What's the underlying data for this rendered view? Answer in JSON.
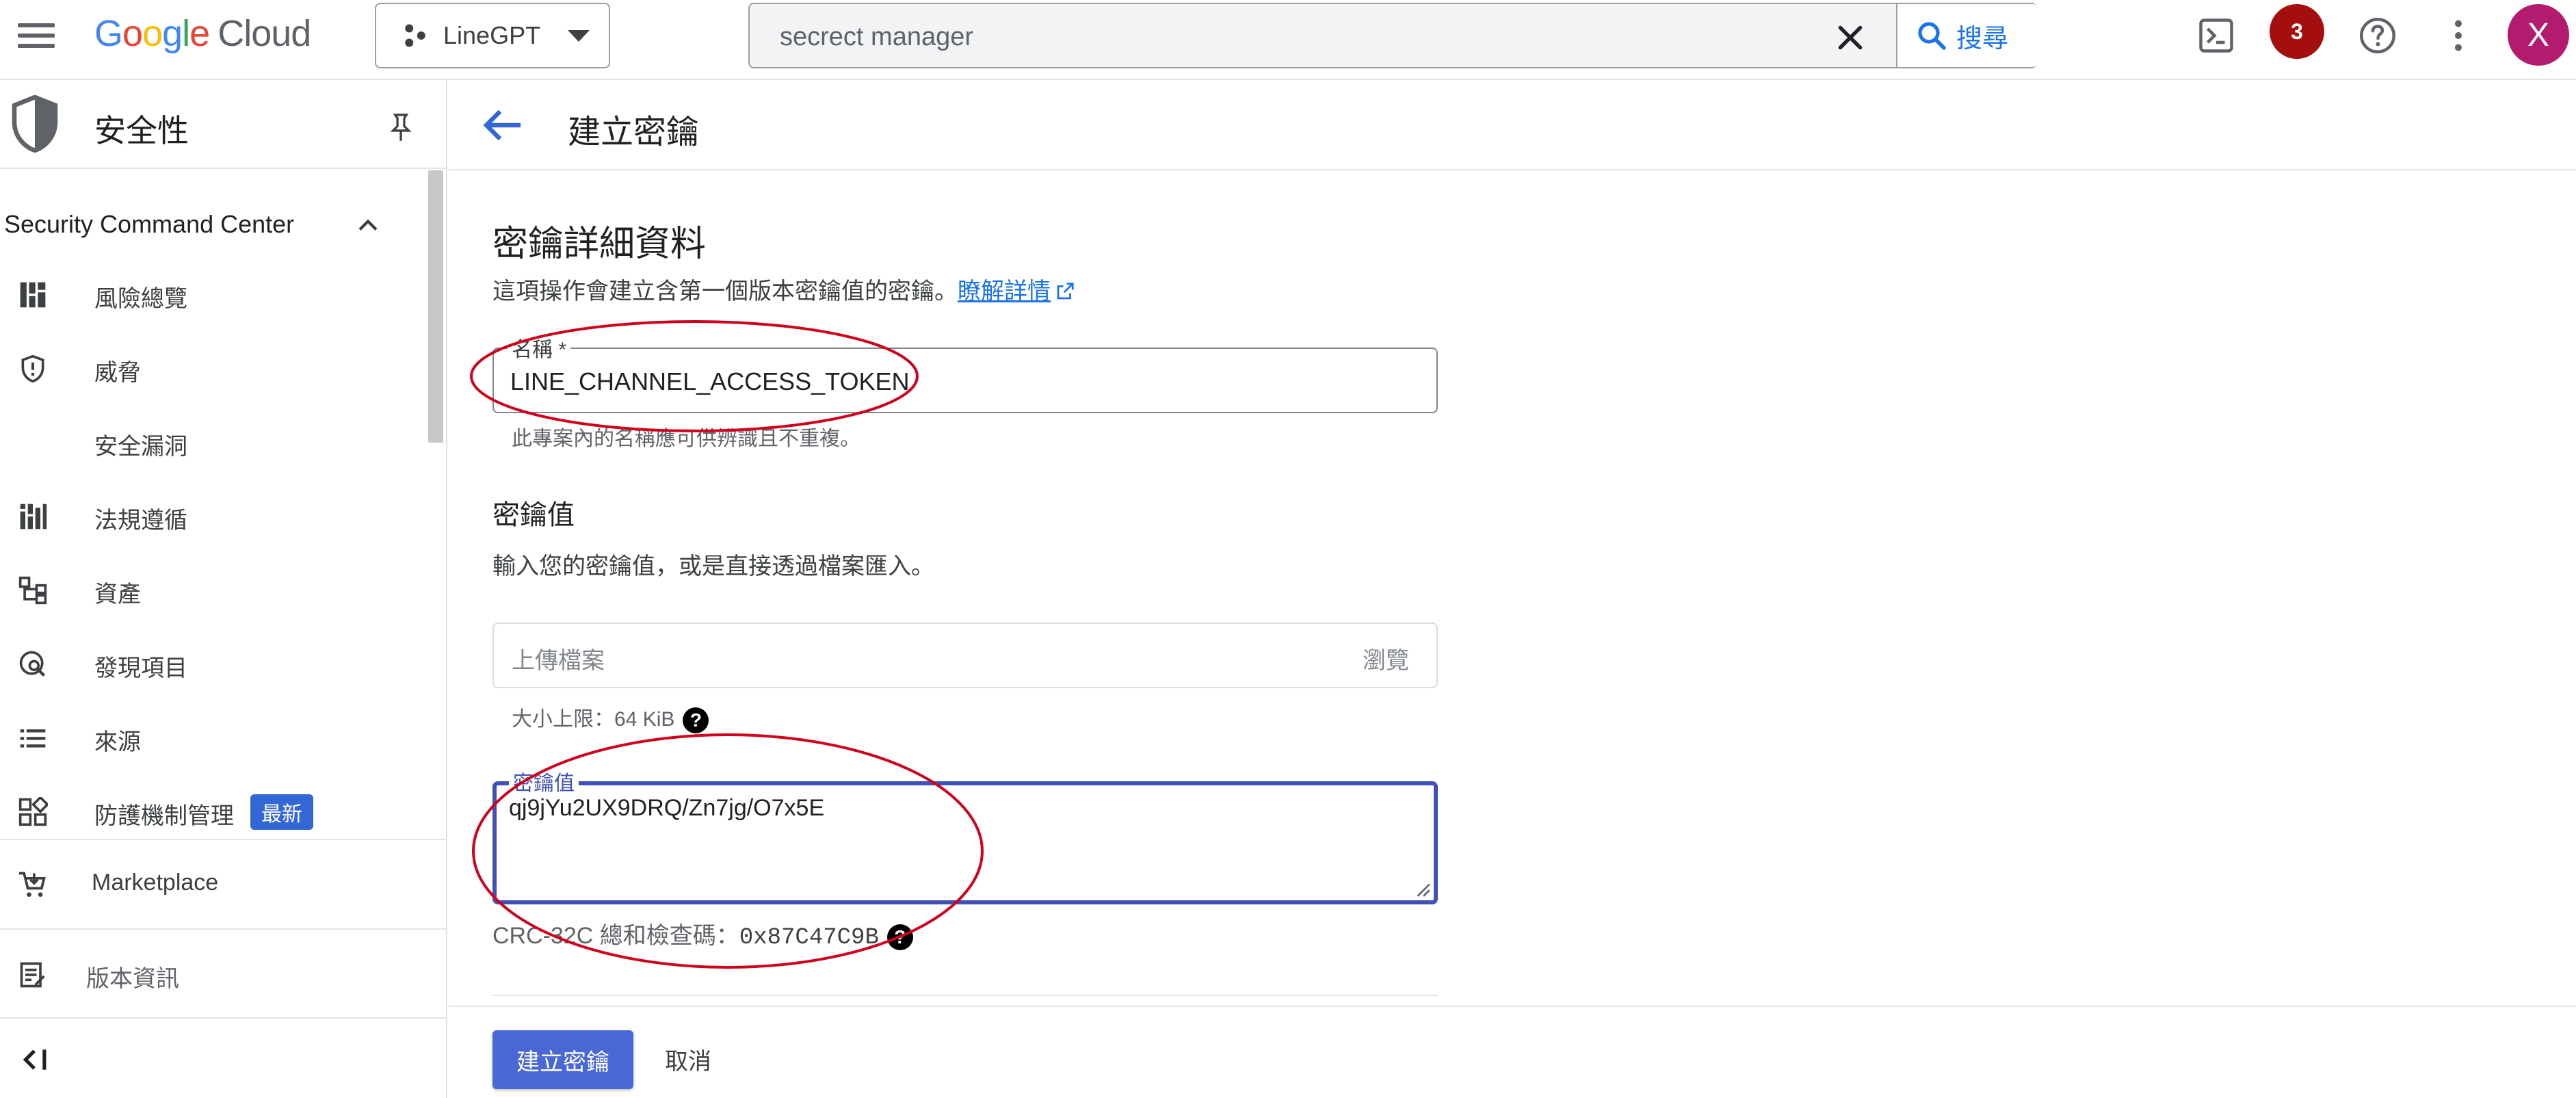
{
  "colors": {
    "accent": "#1a73e8",
    "primary_button": "#4a67d6",
    "focus_border": "#3f51b5",
    "notification_badge": "#a50e0e",
    "avatar": "#b31b6f",
    "new_badge": "#3367d6",
    "annotation": "#d0021b"
  },
  "topbar": {
    "brand_letters": [
      "G",
      "o",
      "o",
      "g",
      "l",
      "e"
    ],
    "brand_product": "Cloud",
    "project_name": "LineGPT",
    "search_value": "secrect manager",
    "search_button_label": "搜尋",
    "notification_count": "3",
    "avatar_letter": "X",
    "icons": [
      "menu-icon",
      "cloud-shell-icon",
      "help-icon",
      "more-vert-icon"
    ]
  },
  "sidebar": {
    "title": "安全性",
    "section_title": "Security Command Center",
    "items": [
      {
        "label": "風險總覽",
        "icon": "dashboard-icon"
      },
      {
        "label": "威脅",
        "icon": "shield-alert-icon"
      },
      {
        "label": "安全漏洞",
        "icon": ""
      },
      {
        "label": "法規遵循",
        "icon": "bar-chart-icon"
      },
      {
        "label": "資產",
        "icon": "hierarchy-icon"
      },
      {
        "label": "發現項目",
        "icon": "search-globe-icon"
      },
      {
        "label": "來源",
        "icon": "list-icon"
      },
      {
        "label": "防護機制管理",
        "icon": "widgets-icon"
      }
    ],
    "new_badge": "最新",
    "marketplace": "Marketplace",
    "release_notes": "版本資訊"
  },
  "main": {
    "page_title": "建立密鑰",
    "details_title": "密鑰詳細資料",
    "details_desc": "這項操作會建立含第一個版本密鑰值的密鑰。",
    "learn_more": "瞭解詳情",
    "name_label": "名稱 *",
    "name_value": "LINE_CHANNEL_ACCESS_TOKEN",
    "name_hint": "此專案內的名稱應可供辨識且不重複。",
    "secret_value_title": "密鑰值",
    "secret_value_desc": "輸入您的密鑰值，或是直接透過檔案匯入。",
    "upload_placeholder": "上傳檔案",
    "browse_label": "瀏覽",
    "size_limit": "大小上限：64 KiB",
    "help_glyph": "?",
    "secret_field_label": "密鑰值",
    "secret_value": "qj9jYu2UX9DRQ/Zn7jg/O7x5E",
    "crc_label": "CRC-32C 總和檢查碼：",
    "crc_value": "0x87C47C9B",
    "create_button": "建立密鑰",
    "cancel_button": "取消"
  }
}
